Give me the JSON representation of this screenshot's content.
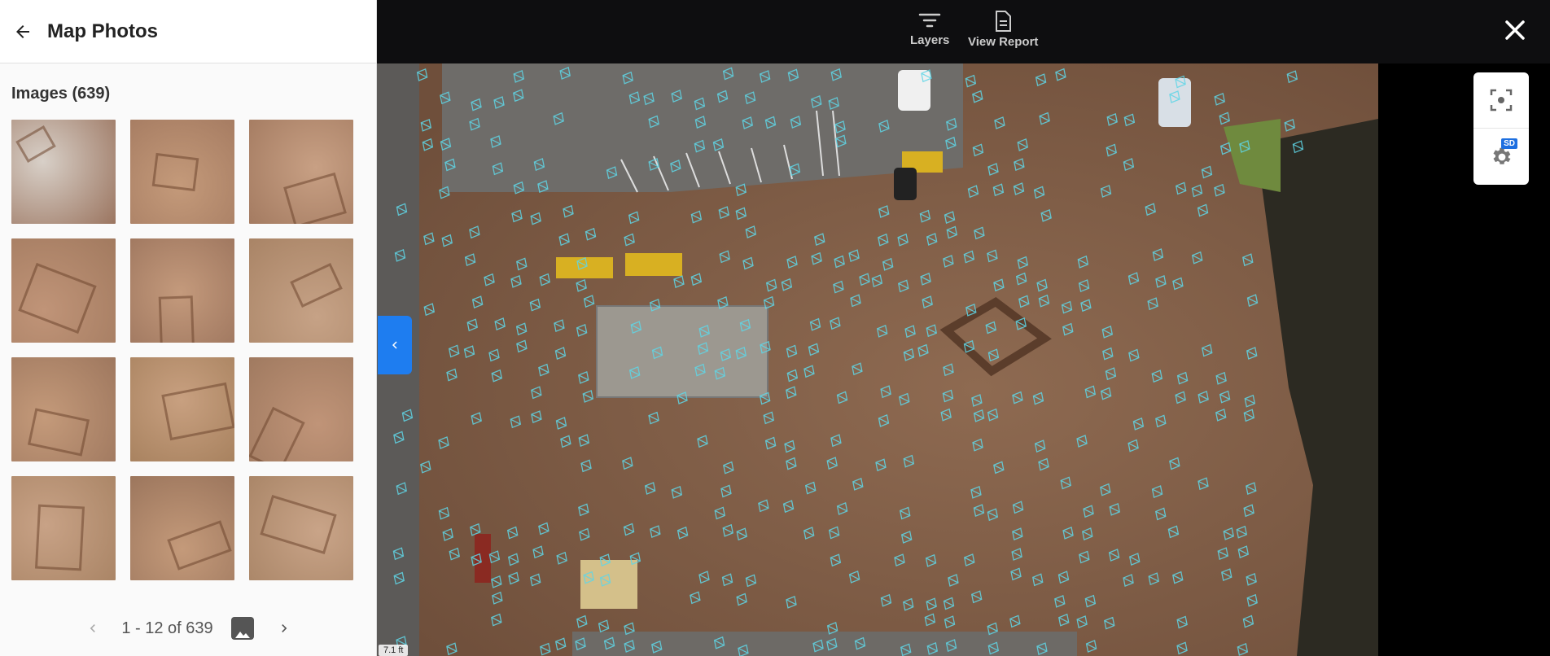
{
  "sidebar": {
    "title": "Map Photos",
    "images_heading": "Images (639)",
    "back_icon": "arrow-left-icon",
    "thumbnails": [
      {
        "id": 1,
        "tone": "#9b7560",
        "accent": "#d8d0c8"
      },
      {
        "id": 2,
        "tone": "#a67c62",
        "accent": "#c49a7a"
      },
      {
        "id": 3,
        "tone": "#a47b61",
        "accent": "#c8a084"
      },
      {
        "id": 4,
        "tone": "#a27a5f",
        "accent": "#c09478"
      },
      {
        "id": 5,
        "tone": "#a07860",
        "accent": "#c49a7c"
      },
      {
        "id": 6,
        "tone": "#a98466",
        "accent": "#c6a286"
      },
      {
        "id": 7,
        "tone": "#9e775e",
        "accent": "#c49a7a"
      },
      {
        "id": 8,
        "tone": "#a8825f",
        "accent": "#c8a080"
      },
      {
        "id": 9,
        "tone": "#a07a60",
        "accent": "#c09478"
      },
      {
        "id": 10,
        "tone": "#aa8566",
        "accent": "#c8a286"
      },
      {
        "id": 11,
        "tone": "#9c765d",
        "accent": "#c49a7a"
      },
      {
        "id": 12,
        "tone": "#aa8668",
        "accent": "#c9a488"
      }
    ],
    "pager": {
      "text": "1 - 12 of 639",
      "prev_icon": "chevron-left-icon",
      "next_icon": "chevron-right-icon",
      "image_icon": "image-icon"
    }
  },
  "toolbar": {
    "layers_label": "Layers",
    "report_label": "View Report",
    "close_icon": "close-icon"
  },
  "map": {
    "scale_label": "7.1 ft",
    "colors": {
      "ground": "#7f5c45",
      "camera_marker": "#5fd6e6",
      "accent": "#1e7df0"
    }
  },
  "settings": {
    "badge": "SD"
  }
}
